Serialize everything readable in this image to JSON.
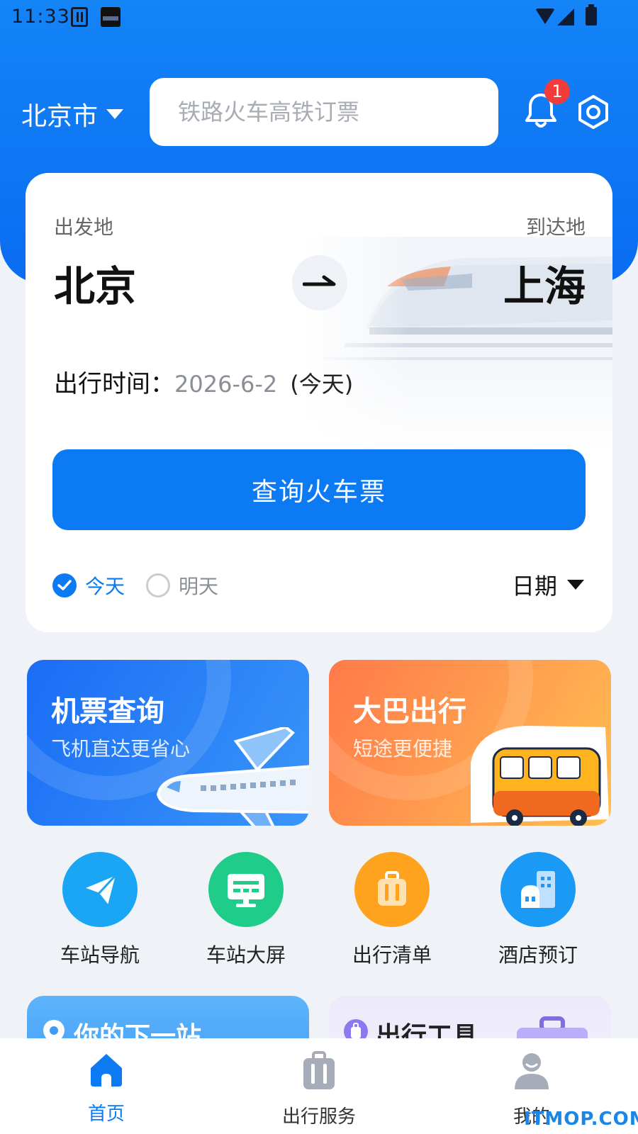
{
  "status_bar": {
    "time": "11:33"
  },
  "header": {
    "city": "北京市",
    "search_placeholder": "铁路火车高铁订票",
    "notification_count": "1"
  },
  "ticket": {
    "from_label": "出发地",
    "to_label": "到达地",
    "from_city": "北京",
    "to_city": "上海",
    "date_label": "出行时间：",
    "date_value": "2026-6-2",
    "date_today": "(今天)",
    "query_button": "查询火车票",
    "option_today": "今天",
    "option_tomorrow": "明天",
    "date_picker": "日期"
  },
  "promos": [
    {
      "title": "机票查询",
      "subtitle": "飞机直达更省心"
    },
    {
      "title": "大巴出行",
      "subtitle": "短途更便捷"
    }
  ],
  "services": [
    {
      "label": "车站导航",
      "icon": "paper-plane-icon",
      "color": "#1aa5f5"
    },
    {
      "label": "车站大屏",
      "icon": "display-screen-icon",
      "color": "#1fcc8a"
    },
    {
      "label": "出行清单",
      "icon": "luggage-icon",
      "color": "#ffa31f"
    },
    {
      "label": "酒店预订",
      "icon": "hotel-building-icon",
      "color": "#1a9af5"
    }
  ],
  "peek_cards": [
    {
      "title": "你的下一站"
    },
    {
      "title": "出行工具"
    }
  ],
  "bottom_nav": [
    {
      "label": "首页",
      "icon": "home-icon",
      "active": true
    },
    {
      "label": "出行服务",
      "icon": "suitcase-icon",
      "active": false
    },
    {
      "label": "我的",
      "icon": "profile-icon",
      "active": false
    }
  ],
  "watermark": "ITMOP.COM",
  "colors": {
    "primary": "#0b7af3",
    "header": "#1484f7",
    "badge": "#f23b3b",
    "flight_card": "#1a6df5",
    "bus_card": "#ff7a4a"
  }
}
